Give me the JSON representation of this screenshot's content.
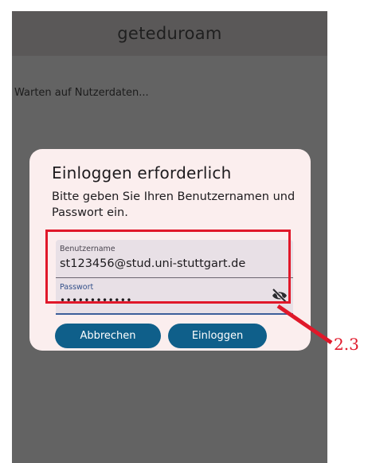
{
  "app": {
    "title": "geteduroam"
  },
  "status": {
    "waiting_text": "Warten auf Nutzerdaten..."
  },
  "dialog": {
    "title": "Einloggen erforderlich",
    "message": "Bitte geben Sie Ihren Benutzernamen und Passwort ein.",
    "username": {
      "label": "Benutzername",
      "value": "st123456@stud.uni-stuttgart.de"
    },
    "password": {
      "label": "Passwort",
      "masked_value": "••••••••••••",
      "toggle_icon": "visibility-off-icon"
    },
    "buttons": {
      "cancel": "Abbrechen",
      "login": "Einloggen"
    }
  },
  "annotation": {
    "label": "2.3",
    "color": "#e0182a"
  },
  "colors": {
    "button": "#0f5f8a",
    "dialog_bg": "#fbeeee",
    "field_bg": "#e8e0e6"
  }
}
